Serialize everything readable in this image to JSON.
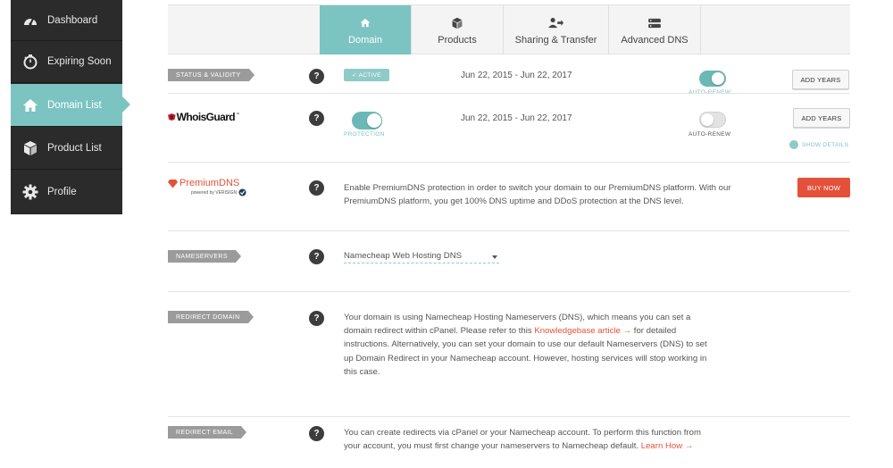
{
  "sidebar": {
    "items": [
      {
        "label": "Dashboard",
        "icon": "dashboard-gauge-icon"
      },
      {
        "label": "Expiring Soon",
        "icon": "stopwatch-icon"
      },
      {
        "label": "Domain List",
        "icon": "home-icon",
        "active": true
      },
      {
        "label": "Product List",
        "icon": "box-icon"
      },
      {
        "label": "Profile",
        "icon": "gear-icon"
      }
    ]
  },
  "tabs": [
    {
      "label": "Domain",
      "icon": "home-icon",
      "active": true
    },
    {
      "label": "Products",
      "icon": "box-icon"
    },
    {
      "label": "Sharing & Transfer",
      "icon": "user-transfer-icon"
    },
    {
      "label": "Advanced DNS",
      "icon": "server-icon"
    }
  ],
  "status": {
    "tag": "STATUS & VALIDITY",
    "badge": "✓ ACTIVE",
    "dates": "Jun 22, 2015 - Jun 22, 2017",
    "toggle_label": "AUTO-RENEW",
    "button": "ADD YEARS"
  },
  "whoisguard": {
    "logo_text": "WhoisGuard",
    "toggle_label": "PROTECTION",
    "dates": "Jun 22, 2015 - Jun 22, 2017",
    "autorenew_label": "AUTO-RENEW",
    "button": "ADD YEARS",
    "show_details": "SHOW DETAILS"
  },
  "premiumdns": {
    "logo_text": "PremiumDNS",
    "powered_by": "powered by VERISIGN",
    "text": "Enable PremiumDNS protection in order to switch your domain to our PremiumDNS platform. With our PremiumDNS platform, you get 100% DNS uptime and DDoS protection at the DNS level.",
    "button": "BUY NOW"
  },
  "nameservers": {
    "tag": "NAMESERVERS",
    "selected": "Namecheap Web Hosting DNS"
  },
  "redirect_domain": {
    "tag": "REDIRECT DOMAIN",
    "text_before": "Your domain is using Namecheap Hosting Nameservers (DNS), which means you can set a domain redirect within cPanel. Please refer to this ",
    "link": "Knowledgebase article →",
    "text_after": " for detailed instructions. Alternatively, you can set your domain to use our default Nameservers (DNS) to set up Domain Redirect in your Namecheap account. However, hosting services will stop working in this case."
  },
  "redirect_email": {
    "tag": "REDIRECT EMAIL",
    "text_before": "You can create redirects via cPanel or your Namecheap account. To perform this function from your account, you must first change your nameservers to Namecheap default. ",
    "link": "Learn How →"
  },
  "help_symbol": "?",
  "colors": {
    "accent": "#7cc4c2",
    "sidebar": "#2b2b2b",
    "danger": "#e4513a",
    "tag": "#9b9b9b"
  }
}
